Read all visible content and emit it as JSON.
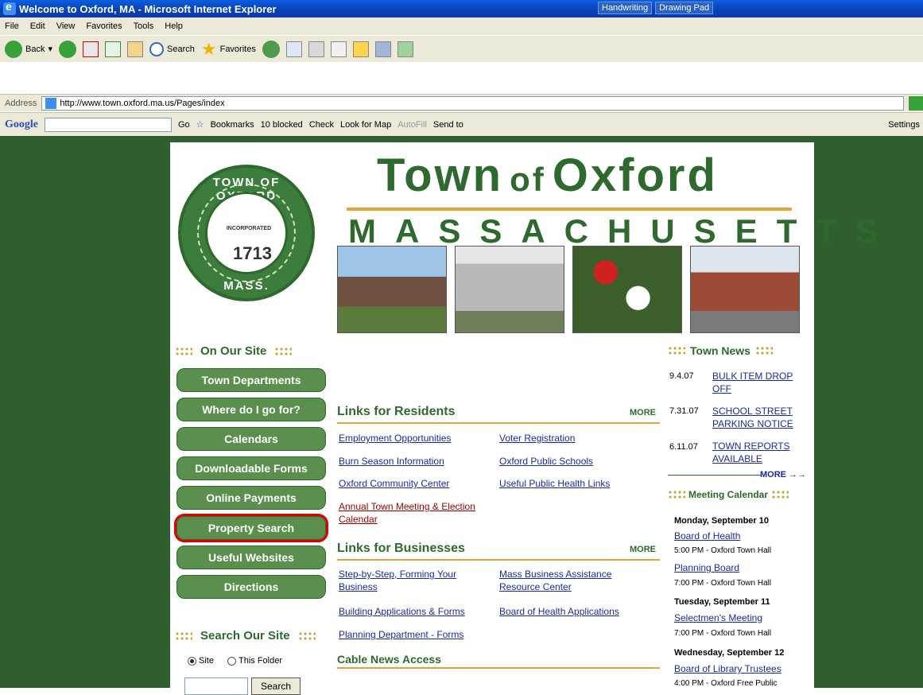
{
  "window": {
    "title": "Welcome to Oxford, MA - Microsoft Internet Explorer",
    "handwriting": "Handwriting",
    "drawing_pad": "Drawing Pad"
  },
  "menu": [
    "File",
    "Edit",
    "View",
    "Favorites",
    "Tools",
    "Help"
  ],
  "toolbar": {
    "back": "Back",
    "search": "Search",
    "favorites": "Favorites"
  },
  "address": {
    "label": "Address",
    "url": "http://www.town.oxford.ma.us/Pages/index"
  },
  "google_bar": {
    "logo": "Google",
    "go": "Go",
    "bookmarks": "Bookmarks",
    "blocked": "10 blocked",
    "check": "Check",
    "lookformap": "Look for Map",
    "autofill": "AutoFill",
    "sendto": "Send to",
    "settings": "Settings"
  },
  "seal": {
    "top": "TOWN OF OXFORD",
    "incorporated": "INCORPORATED",
    "year": "1713",
    "bottom": "MASS."
  },
  "header": {
    "town": "Town",
    "of": "of",
    "oxford": "Oxford",
    "state": "MASSACHUSETTS"
  },
  "sidebar": {
    "heading": "On Our Site",
    "items": [
      "Town Departments",
      "Where do I go for?",
      "Calendars",
      "Downloadable Forms",
      "Online Payments",
      "Property Search",
      "Useful Websites",
      "Directions"
    ],
    "search_heading": "Search Our Site",
    "radio_site": "Site",
    "radio_folder": "This Folder",
    "search_button": "Search"
  },
  "residents": {
    "heading": "Links for Residents",
    "more": "MORE",
    "links": [
      "Employment Opportunities",
      "Voter Registration",
      "Burn Season Information",
      "Oxford Public Schools",
      "Oxford Community Center",
      "Useful Public Health Links",
      "Annual Town Meeting & Election Calendar"
    ]
  },
  "businesses": {
    "heading": "Links for Businesses",
    "more": "MORE",
    "links": [
      "Step-by-Step, Forming Your Business",
      "Mass Business Assistance Resource Center",
      "Building Applications & Forms",
      "Board of Health Applications",
      "Planning Department - Forms"
    ]
  },
  "cable": {
    "heading": "Cable News Access"
  },
  "news": {
    "heading": "Town News",
    "items": [
      {
        "date": "9.4.07",
        "title": "BULK ITEM DROP OFF"
      },
      {
        "date": "7.31.07",
        "title": "SCHOOL STREET PARKING NOTICE"
      },
      {
        "date": "6.11.07",
        "title": "TOWN REPORTS AVAILABLE"
      }
    ],
    "more": "MORE"
  },
  "calendar": {
    "heading": "Meeting Calendar",
    "days": [
      {
        "day": "Monday, September 10",
        "events": [
          {
            "name": "Board of Health",
            "info": "5:00 PM - Oxford Town Hall"
          },
          {
            "name": "Planning Board",
            "info": "7:00 PM - Oxford Town Hall"
          }
        ]
      },
      {
        "day": "Tuesday, September 11",
        "events": [
          {
            "name": "Selectmen's Meeting",
            "info": "7:00 PM - Oxford Town Hall"
          }
        ]
      },
      {
        "day": "Wednesday, September 12",
        "events": [
          {
            "name": "Board of Library Trustees",
            "info": "4:00 PM - Oxford Free Public"
          }
        ]
      }
    ]
  },
  "colors": {
    "green": "#2e6a2e",
    "orange": "#e8a33a",
    "link": "#1a2aa6",
    "highlight": "#e00000"
  }
}
